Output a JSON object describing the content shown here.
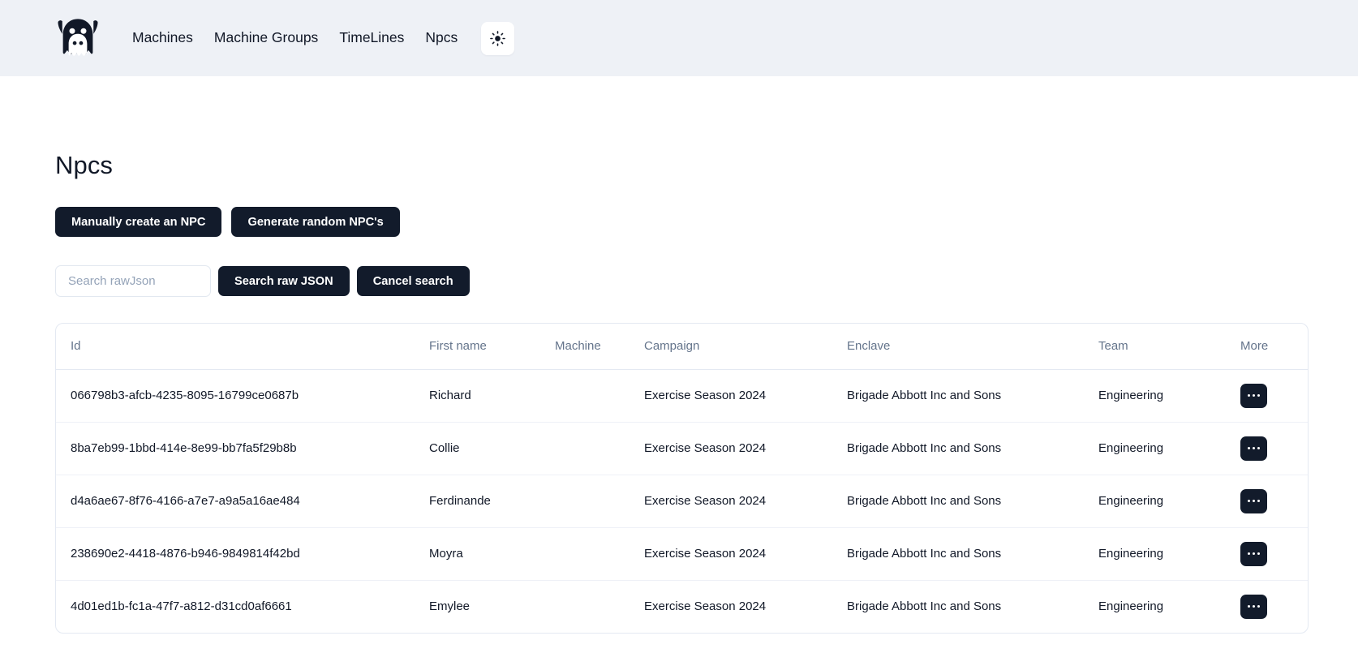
{
  "nav": {
    "logo_icon": "ghost-logo-icon",
    "links": [
      {
        "label": "Machines"
      },
      {
        "label": "Machine Groups"
      },
      {
        "label": "TimeLines"
      },
      {
        "label": "Npcs"
      }
    ],
    "theme_toggle_icon": "sun-icon"
  },
  "page": {
    "title": "Npcs"
  },
  "actions": {
    "manual_create_label": "Manually create an NPC",
    "generate_random_label": "Generate random NPC's"
  },
  "search": {
    "placeholder": "Search rawJson",
    "value": "",
    "search_button_label": "Search raw JSON",
    "cancel_button_label": "Cancel search"
  },
  "table": {
    "columns": [
      {
        "key": "id",
        "label": "Id"
      },
      {
        "key": "first_name",
        "label": "First name"
      },
      {
        "key": "machine",
        "label": "Machine"
      },
      {
        "key": "campaign",
        "label": "Campaign"
      },
      {
        "key": "enclave",
        "label": "Enclave"
      },
      {
        "key": "team",
        "label": "Team"
      },
      {
        "key": "more",
        "label": "More"
      }
    ],
    "rows": [
      {
        "id": "066798b3-afcb-4235-8095-16799ce0687b",
        "first_name": "Richard",
        "machine": "",
        "campaign": "Exercise Season 2024",
        "enclave": "Brigade Abbott Inc and Sons",
        "team": "Engineering",
        "more_icon": "ellipsis-icon"
      },
      {
        "id": "8ba7eb99-1bbd-414e-8e99-bb7fa5f29b8b",
        "first_name": "Collie",
        "machine": "",
        "campaign": "Exercise Season 2024",
        "enclave": "Brigade Abbott Inc and Sons",
        "team": "Engineering",
        "more_icon": "ellipsis-icon"
      },
      {
        "id": "d4a6ae67-8f76-4166-a7e7-a9a5a16ae484",
        "first_name": "Ferdinande",
        "machine": "",
        "campaign": "Exercise Season 2024",
        "enclave": "Brigade Abbott Inc and Sons",
        "team": "Engineering",
        "more_icon": "ellipsis-icon"
      },
      {
        "id": "238690e2-4418-4876-b946-9849814f42bd",
        "first_name": "Moyra",
        "machine": "",
        "campaign": "Exercise Season 2024",
        "enclave": "Brigade Abbott Inc and Sons",
        "team": "Engineering",
        "more_icon": "ellipsis-icon"
      },
      {
        "id": "4d01ed1b-fc1a-47f7-a812-d31cd0af6661",
        "first_name": "Emylee",
        "machine": "",
        "campaign": "Exercise Season 2024",
        "enclave": "Brigade Abbott Inc and Sons",
        "team": "Engineering",
        "more_icon": "ellipsis-icon"
      }
    ]
  },
  "colors": {
    "navbar_bg": "#eef1f6",
    "page_bg": "#ffffff",
    "button_dark": "#121b2b",
    "text_primary": "#111827",
    "text_muted": "#64748b",
    "border": "#e4e9f2"
  }
}
